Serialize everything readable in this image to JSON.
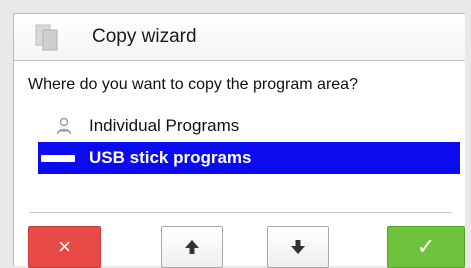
{
  "dialog": {
    "title": "Copy wizard",
    "title_icon": "copy-documents-icon"
  },
  "question": "Where do you want to copy the program area?",
  "options": [
    {
      "label": "Individual Programs",
      "icon": "person-icon",
      "selected": false
    },
    {
      "label": "USB stick programs",
      "icon": "usb-stick-icon",
      "selected": true
    }
  ],
  "buttons": {
    "cancel": {
      "glyph": "×",
      "icon": "close-icon"
    },
    "up": {
      "icon": "arrow-up-icon"
    },
    "down": {
      "icon": "arrow-down-icon"
    },
    "ok": {
      "glyph": "✓",
      "icon": "checkmark-icon"
    }
  },
  "colors": {
    "selection": "#0b0bef",
    "cancel": "#e84a45",
    "ok": "#6fc23c"
  }
}
